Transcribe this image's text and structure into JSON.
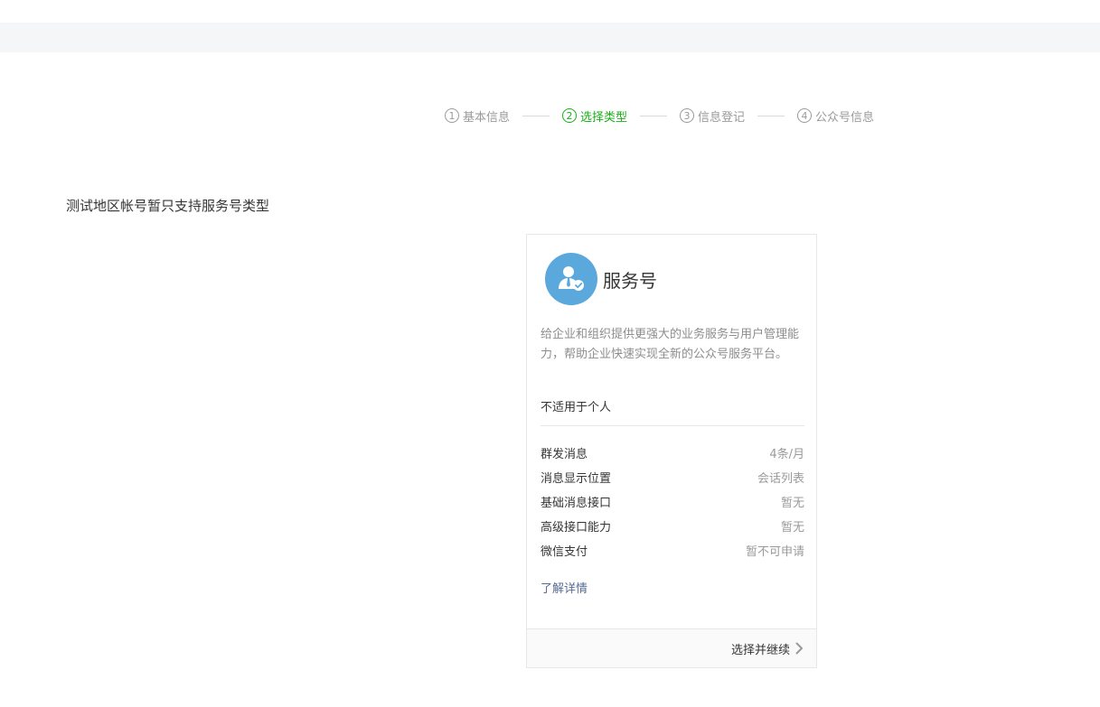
{
  "steps": [
    {
      "num": "1",
      "label": "基本信息",
      "active": false
    },
    {
      "num": "2",
      "label": "选择类型",
      "active": true
    },
    {
      "num": "3",
      "label": "信息登记",
      "active": false
    },
    {
      "num": "4",
      "label": "公众号信息",
      "active": false
    }
  ],
  "notice": "测试地区帐号暂只支持服务号类型",
  "card": {
    "icon": "service-account-icon",
    "title": "服务号",
    "description": "给企业和组织提供更强大的业务服务与用户管理能力，帮助企业快速实现全新的公众号服务平台。",
    "not_for": "不适用于个人",
    "features": [
      {
        "label": "群发消息",
        "value": "4条/月"
      },
      {
        "label": "消息显示位置",
        "value": "会话列表"
      },
      {
        "label": "基础消息接口",
        "value": "暂无"
      },
      {
        "label": "高级接口能力",
        "value": "暂无"
      },
      {
        "label": "微信支付",
        "value": "暂不可申请"
      }
    ],
    "detail_link": "了解详情",
    "continue_label": "选择并继续"
  },
  "colors": {
    "accent_green": "#1aad19",
    "avatar_blue": "#5aa8dc",
    "link_blue": "#576b95"
  }
}
